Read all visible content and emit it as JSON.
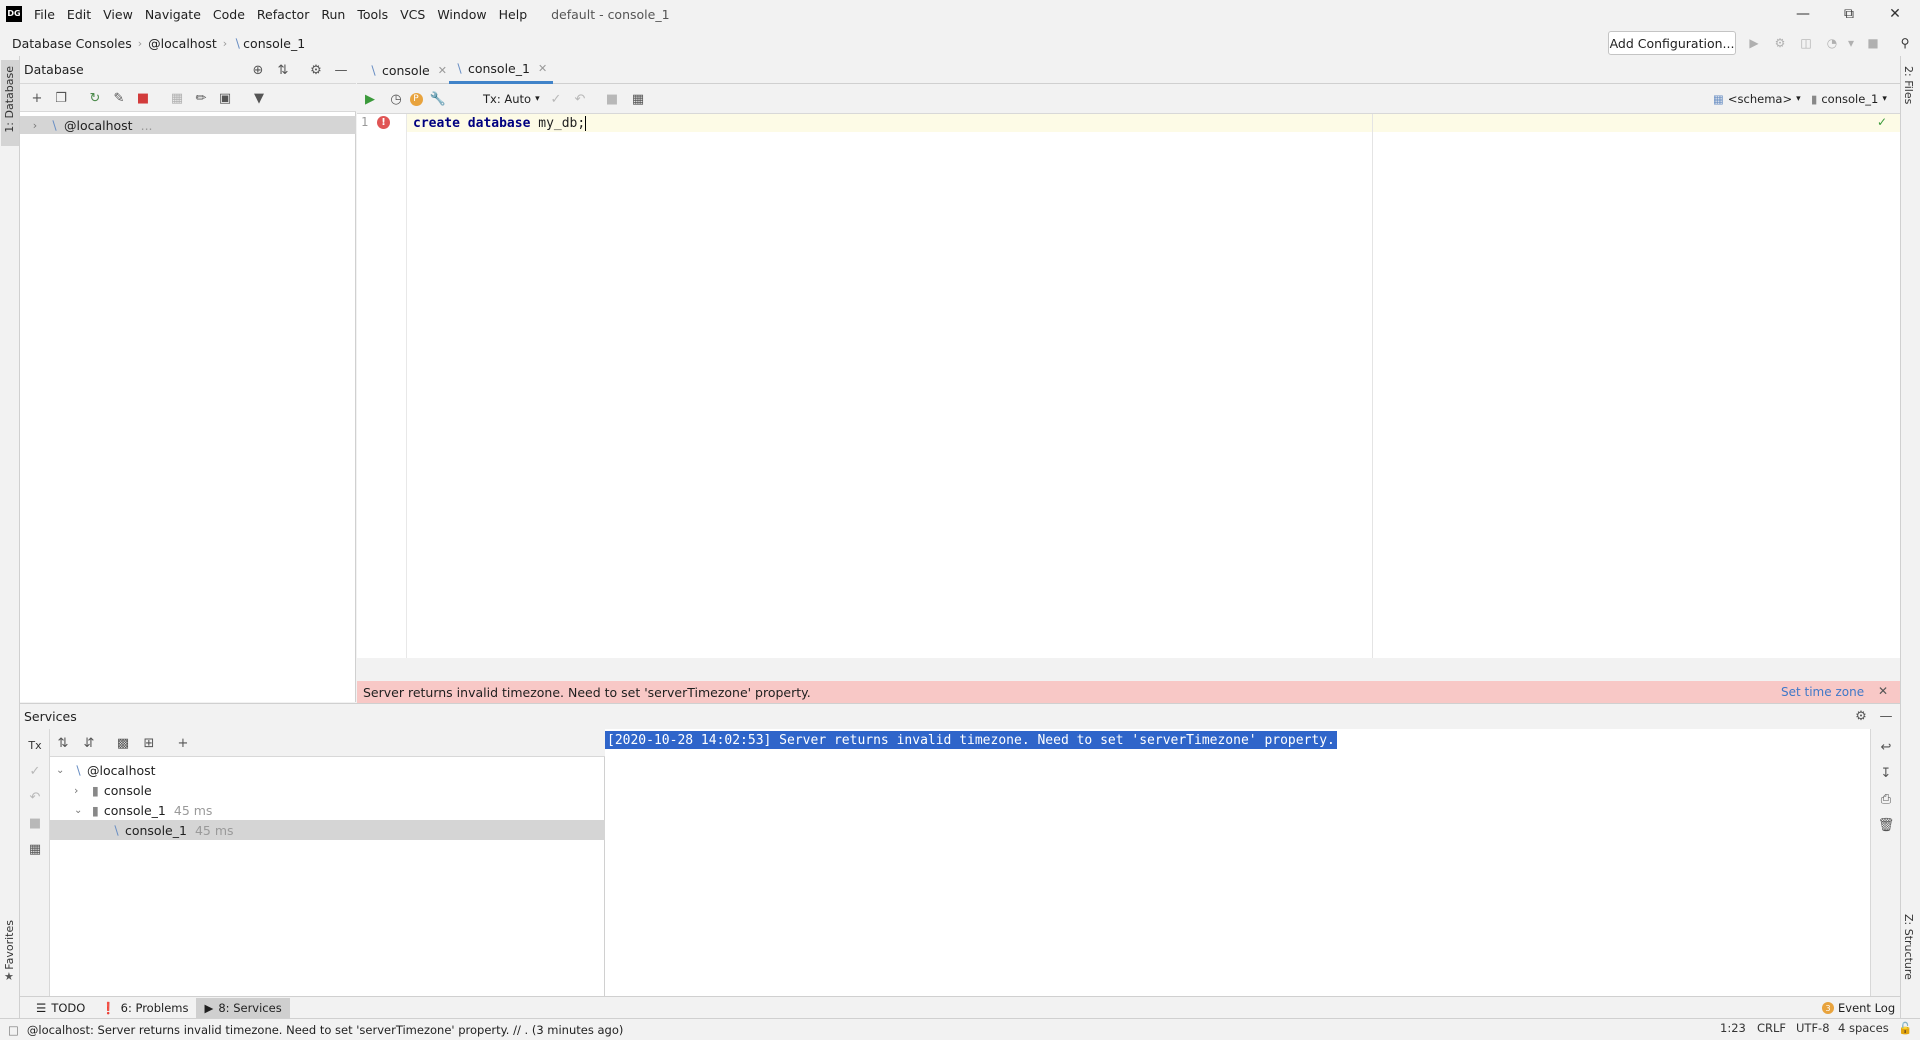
{
  "app": {
    "logo": "DG",
    "window_title": "default - console_1",
    "menu": [
      "File",
      "Edit",
      "View",
      "Navigate",
      "Code",
      "Refactor",
      "Run",
      "Tools",
      "VCS",
      "Window",
      "Help"
    ]
  },
  "navbar": {
    "breadcrumbs": [
      "Database Consoles",
      "@localhost",
      "console_1"
    ],
    "add_configuration": "Add Configuration..."
  },
  "left_stripe": {
    "database": "1: Database",
    "favorites": "Favorites"
  },
  "right_stripe": {
    "files": "2: Files",
    "structure": "Z: Structure"
  },
  "database_panel": {
    "title": "Database",
    "tree": [
      {
        "label": "@localhost",
        "extra": "..."
      }
    ]
  },
  "editor": {
    "tabs": [
      {
        "label": "console",
        "active": false
      },
      {
        "label": "console_1",
        "active": true
      }
    ],
    "tx_mode": "Tx: Auto",
    "schema_selector": "<schema>",
    "session_selector": "console_1",
    "line_number": "1",
    "code": {
      "kw1": "create",
      "kw2": "database",
      "ident": "my_db",
      "end": ";"
    }
  },
  "error_banner": {
    "message": "Server returns invalid timezone. Need to set 'serverTimezone' property.",
    "action": "Set time zone"
  },
  "services": {
    "title": "Services",
    "tx_label": "Tx",
    "tree": [
      {
        "label": "@localhost",
        "time": ""
      },
      {
        "label": "console",
        "time": ""
      },
      {
        "label": "console_1",
        "time": "45 ms"
      },
      {
        "label": "console_1",
        "time": "45 ms"
      }
    ],
    "output": "[2020-10-28 14:02:53] Server returns invalid timezone. Need to set 'serverTimezone' property."
  },
  "bottom_tools": {
    "todo": "TODO",
    "problems": "6: Problems",
    "services": "8: Services",
    "event_log": "Event Log",
    "event_count": "3"
  },
  "statusbar": {
    "message": "@localhost: Server returns invalid timezone. Need to set 'serverTimezone' property. // . (3 minutes ago)",
    "position": "1:23",
    "line_sep": "CRLF",
    "encoding": "UTF-8",
    "indent": "4 spaces"
  }
}
